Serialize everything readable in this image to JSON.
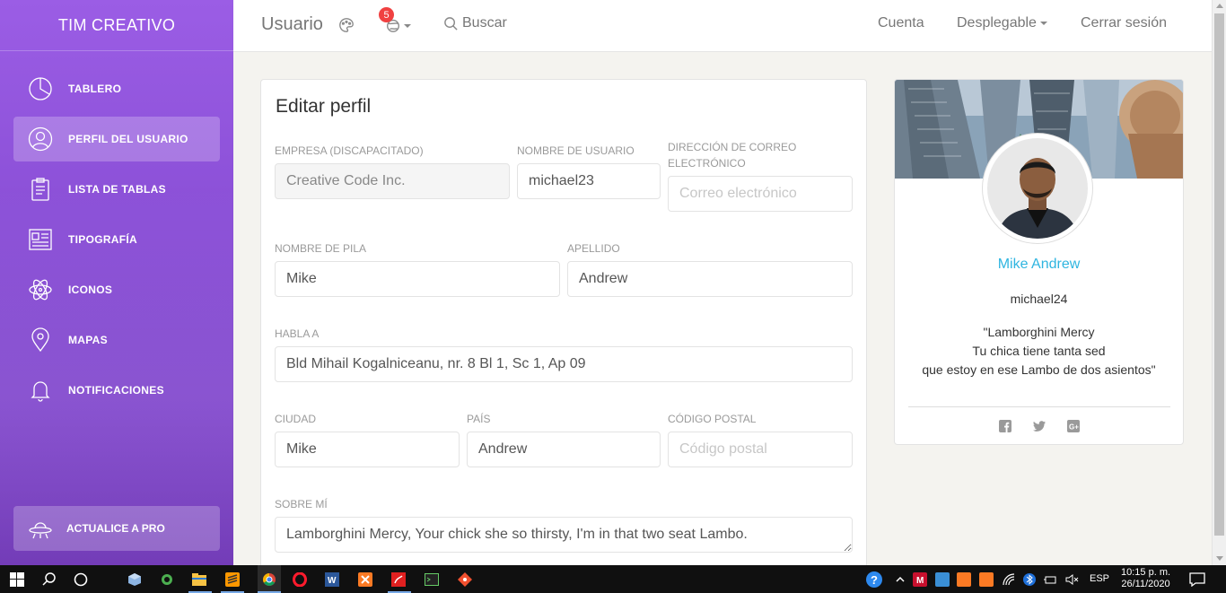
{
  "sidebar": {
    "brand": "TIM CREATIVO",
    "items": [
      {
        "label": "TABLERO",
        "icon": "pie-chart-icon"
      },
      {
        "label": "PERFIL DEL USUARIO",
        "icon": "user-circle-icon"
      },
      {
        "label": "LISTA DE TABLAS",
        "icon": "clipboard-icon"
      },
      {
        "label": "TIPOGRAFÍA",
        "icon": "newspaper-icon"
      },
      {
        "label": "ICONOS",
        "icon": "atom-icon"
      },
      {
        "label": "MAPAS",
        "icon": "map-pin-icon"
      },
      {
        "label": "NOTIFICACIONES",
        "icon": "bell-icon"
      }
    ],
    "active_item": "PERFIL DEL USUARIO",
    "upgrade": "ACTUALICE A PRO"
  },
  "navbar": {
    "title": "Usuario",
    "notification_count": "5",
    "search_label": "Buscar",
    "account": "Cuenta",
    "dropdown": "Desplegable",
    "logout": "Cerrar sesión"
  },
  "edit_profile": {
    "title": "Editar perfil",
    "company_label": "EMPRESA (DISCAPACITADO)",
    "company_value": "Creative Code Inc.",
    "username_label": "NOMBRE DE USUARIO",
    "username_value": "michael23",
    "email_label": "DIRECCIÓN DE CORREO ELECTRÓNICO",
    "email_placeholder": "Correo electrónico",
    "firstname_label": "NOMBRE DE PILA",
    "firstname_value": "Mike",
    "lastname_label": "APELLIDO",
    "lastname_value": "Andrew",
    "address_label": "HABLA A",
    "address_value": "Bld Mihail Kogalniceanu, nr. 8 Bl 1, Sc 1, Ap 09",
    "city_label": "CIUDAD",
    "city_value": "Mike",
    "country_label": "PAÍS",
    "country_value": "Andrew",
    "postal_label": "CÓDIGO POSTAL",
    "postal_placeholder": "Código postal",
    "about_label": "SOBRE MÍ",
    "about_value": "Lamborghini Mercy, Your chick she so thirsty, I'm in that two seat Lambo."
  },
  "user_card": {
    "name": "Mike Andrew",
    "handle": "michael24",
    "quote_line1": "\"Lamborghini Mercy",
    "quote_line2": "Tu chica tiene tanta sed",
    "quote_line3": "que estoy en ese Lambo de dos asientos\"",
    "social": [
      "facebook-icon",
      "twitter-icon",
      "google-plus-icon"
    ]
  },
  "taskbar": {
    "language": "ESP",
    "time": "10:15 p. m.",
    "date": "26/11/2020"
  },
  "colors": {
    "sidebar_top": "#9b5de5",
    "sidebar_bottom": "#6a30b3",
    "accent_name": "#2fb5e0",
    "badge": "#f04141"
  }
}
